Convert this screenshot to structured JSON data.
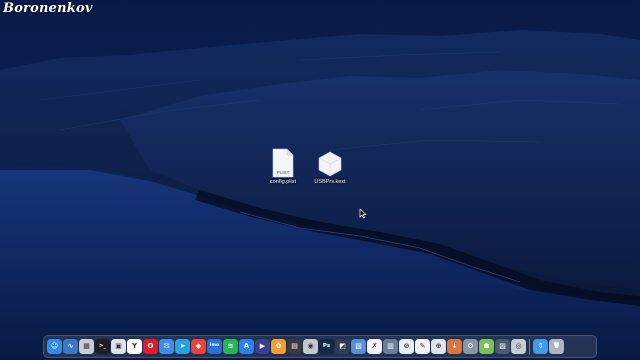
{
  "watermark": "Boronenkov",
  "desktop_icons": [
    {
      "name": "config.plist",
      "badge": "PLIST",
      "icon": "plist-file-icon"
    },
    {
      "name": "USBPrs.kext",
      "badge": "",
      "icon": "kext-bundle-icon"
    }
  ],
  "dock": {
    "apps": [
      {
        "icon": "finder-icon",
        "color": "#2e8cf0",
        "glyph": "☺"
      },
      {
        "icon": "activity-monitor-icon",
        "color": "#3a78c8",
        "glyph": "∿"
      },
      {
        "icon": "launchpad-icon",
        "color": "#c9cdd6",
        "glyph": "▦"
      },
      {
        "icon": "terminal-icon",
        "color": "#1e1e1e",
        "glyph": ">_"
      },
      {
        "icon": "system-info-icon",
        "color": "#dfe3ea",
        "glyph": "▣"
      },
      {
        "icon": "yandex-browser-icon",
        "color": "#ffffff",
        "glyph": "Y"
      },
      {
        "icon": "opera-browser-icon",
        "color": "#e0192f",
        "glyph": "O"
      },
      {
        "icon": "mail-icon",
        "color": "#3b8df2",
        "glyph": "✉"
      },
      {
        "icon": "telegram-icon",
        "color": "#2aa1e0",
        "glyph": "➤"
      },
      {
        "icon": "anydesk-icon",
        "color": "#e8443a",
        "glyph": "◆"
      },
      {
        "icon": "imo-messenger-icon",
        "color": "#2a6fdb",
        "glyph": "imo"
      },
      {
        "icon": "spotify-icon",
        "color": "#1db954",
        "glyph": "≋"
      },
      {
        "icon": "app-store-icon",
        "color": "#2a82f0",
        "glyph": "A"
      },
      {
        "icon": "media-player-icon",
        "color": "#3b3f8f",
        "glyph": "▶"
      },
      {
        "icon": "photo-browser-icon",
        "color": "#f0a030",
        "glyph": "✿"
      },
      {
        "icon": "video-editor-icon",
        "color": "#3a3a3a",
        "glyph": "▤"
      },
      {
        "icon": "disk-utility-icon",
        "color": "#c3c8d0",
        "glyph": "◉"
      },
      {
        "icon": "photoshop-icon",
        "color": "#0f2a45",
        "glyph": "Ps"
      },
      {
        "icon": "screen-capture-icon",
        "color": "#2c3e56",
        "glyph": "◩"
      },
      {
        "icon": "preview-icon",
        "color": "#5a8fd8",
        "glyph": "▧"
      },
      {
        "icon": "text-editor-icon",
        "color": "#f2f2f2",
        "glyph": "✗"
      },
      {
        "icon": "notes-icon",
        "color": "#6a7e9a",
        "glyph": "▥"
      },
      {
        "icon": "safari-icon",
        "color": "#e8eef6",
        "glyph": "⊘"
      },
      {
        "icon": "textedit-icon",
        "color": "#f4f4f4",
        "glyph": "✎"
      },
      {
        "icon": "compass-icon",
        "color": "#dfe4ec",
        "glyph": "⊕"
      },
      {
        "icon": "download-manager-icon",
        "color": "#d9773a",
        "glyph": "↓"
      },
      {
        "icon": "system-preferences-icon",
        "color": "#8a95a6",
        "glyph": "⚙"
      },
      {
        "icon": "android-file-transfer-icon",
        "color": "#79c257",
        "glyph": "☗"
      },
      {
        "icon": "image-capture-icon",
        "color": "#4a5a70",
        "glyph": "▨"
      },
      {
        "icon": "network-utility-icon",
        "color": "#c8ccd4",
        "glyph": "◎"
      }
    ],
    "folder": {
      "icon": "downloads-folder-icon",
      "color": "#3d9be9",
      "glyph": "⇩"
    },
    "trash": {
      "icon": "trash-icon",
      "color": "#aeb5c2",
      "glyph": "🗑"
    }
  }
}
